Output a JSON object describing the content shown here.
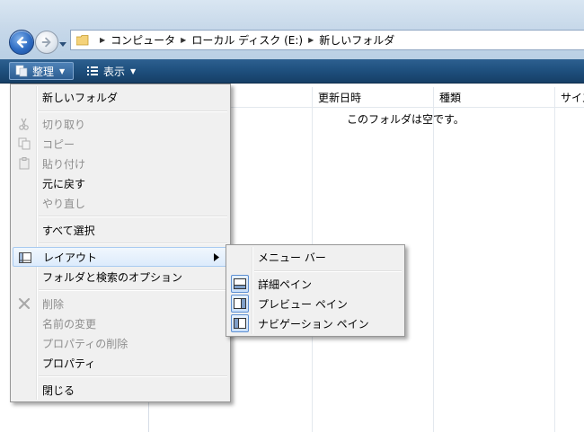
{
  "address": {
    "breadcrumbs": [
      "コンピュータ",
      "ローカル ディスク (E:)",
      "新しいフォルダ"
    ]
  },
  "toolbar": {
    "organize_label": "整理",
    "view_label": "表示"
  },
  "filelist": {
    "columns": [
      "更新日時",
      "種類",
      "サイズ"
    ],
    "empty_message": "このフォルダは空です。"
  },
  "menu": {
    "new_folder": "新しいフォルダ",
    "cut": "切り取り",
    "copy": "コピー",
    "paste": "貼り付け",
    "undo": "元に戻す",
    "redo": "やり直し",
    "select_all": "すべて選択",
    "layout": "レイアウト",
    "folder_options": "フォルダと検索のオプション",
    "delete": "削除",
    "rename": "名前の変更",
    "remove_properties": "プロパティの削除",
    "properties": "プロパティ",
    "close": "閉じる"
  },
  "submenu": {
    "menu_bar": "メニュー バー",
    "details_pane": "詳細ペイン",
    "preview_pane": "プレビュー ペイン",
    "navigation_pane": "ナビゲーション ペイン"
  },
  "colors": {
    "toolbar": "#1e4f7d",
    "highlight_border": "#a8caf0",
    "disabled_text": "#8d8d8d"
  }
}
